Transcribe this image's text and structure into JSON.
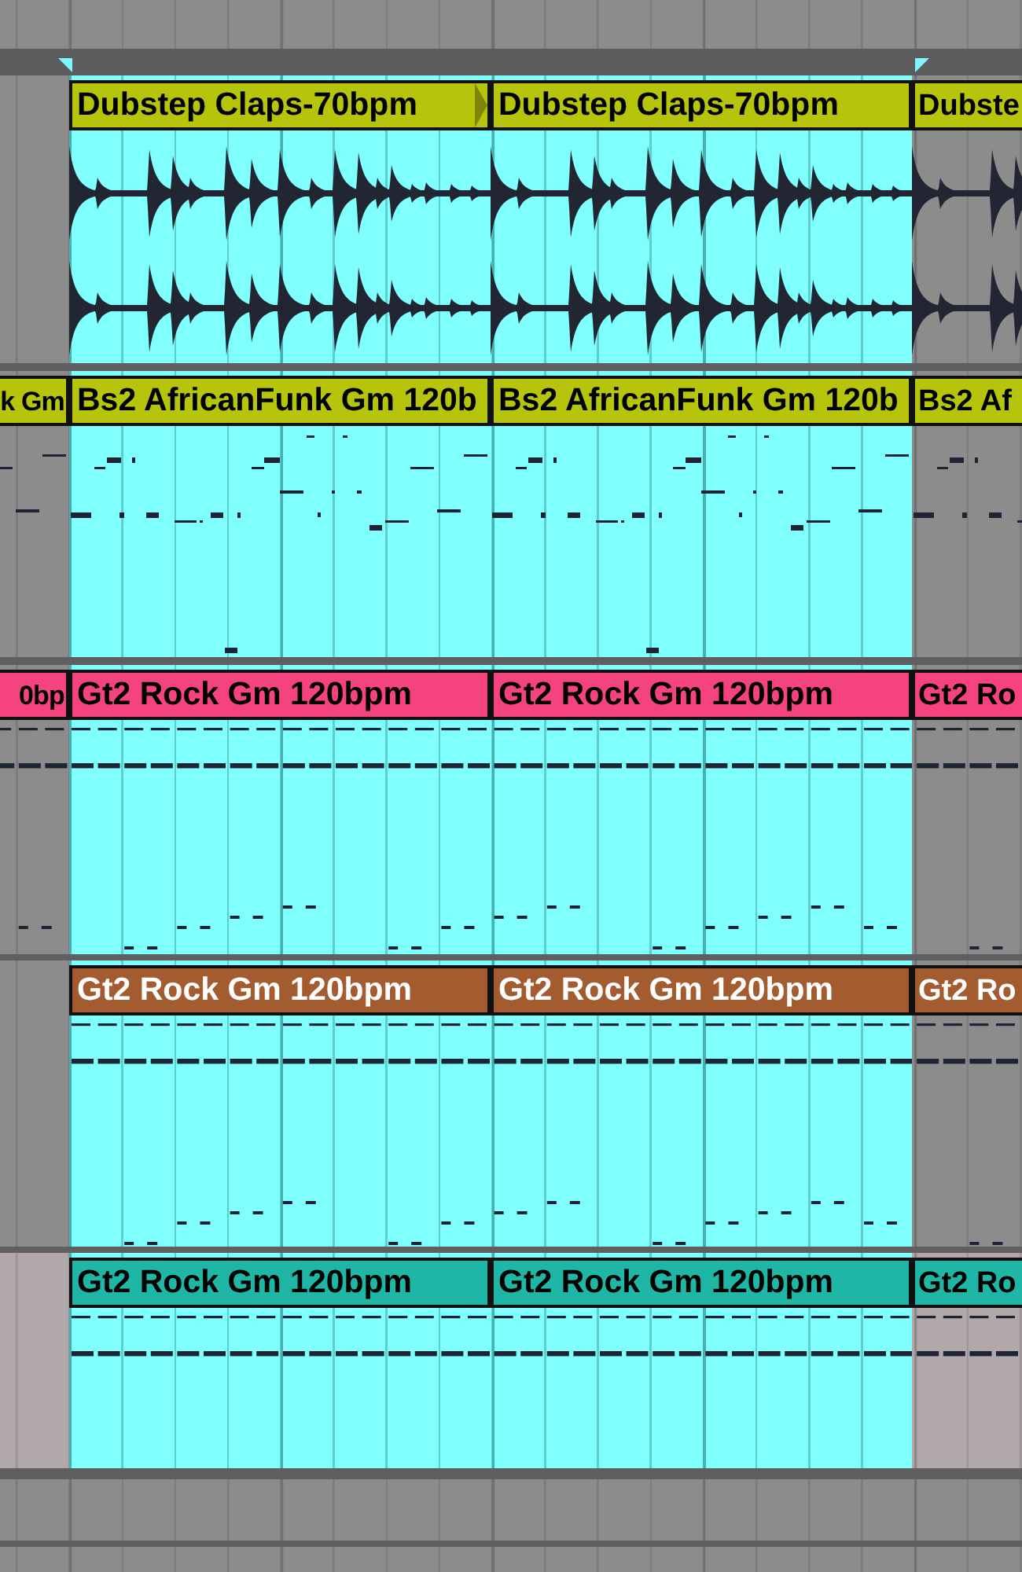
{
  "loop_brace": {
    "on": true
  },
  "tracks": [
    {
      "kind": "audio",
      "selected": false,
      "clips": [
        {
          "kind": "full",
          "name": "Dubstep Claps-70bpm",
          "color": "#b6c50b",
          "selected": true,
          "end_marker": true
        },
        {
          "kind": "full",
          "name": "Dubstep Claps-70bpm",
          "color": "#b6c50b",
          "selected": true,
          "end_marker": false
        },
        {
          "kind": "cut_right",
          "name": "Dubste",
          "color": "#b6c50b",
          "selected": false,
          "end_marker": false
        }
      ]
    },
    {
      "kind": "midi",
      "selected": false,
      "clips": [
        {
          "kind": "cut_left",
          "name": "k Gm",
          "color": "#b6c50b",
          "selected": false,
          "end_marker": false
        },
        {
          "kind": "full",
          "name": "Bs2 AfricanFunk Gm 120b",
          "color": "#b6c50b",
          "selected": true,
          "end_marker": false
        },
        {
          "kind": "full",
          "name": "Bs2 AfricanFunk Gm 120b",
          "color": "#b6c50b",
          "selected": true,
          "end_marker": false
        },
        {
          "kind": "cut_right",
          "name": "Bs2 Af",
          "color": "#b6c50b",
          "selected": false,
          "end_marker": false
        }
      ]
    },
    {
      "kind": "midi",
      "selected": false,
      "clips": [
        {
          "kind": "cut_left",
          "name": "0bp",
          "color": "#f4437f",
          "selected": false,
          "end_marker": false
        },
        {
          "kind": "full",
          "name": "Gt2 Rock Gm 120bpm",
          "color": "#f4437f",
          "selected": true,
          "end_marker": false
        },
        {
          "kind": "full",
          "name": "Gt2 Rock Gm 120bpm",
          "color": "#f4437f",
          "selected": true,
          "end_marker": false
        },
        {
          "kind": "cut_right",
          "name": "Gt2 Ro",
          "color": "#f4437f",
          "selected": false,
          "end_marker": false
        }
      ]
    },
    {
      "kind": "midi",
      "selected": false,
      "clips": [
        {
          "kind": "full",
          "name": "Gt2 Rock Gm 120bpm",
          "color": "#a35b30",
          "selected": true,
          "end_marker": false
        },
        {
          "kind": "full",
          "name": "Gt2 Rock Gm 120bpm",
          "color": "#a35b30",
          "selected": true,
          "end_marker": false
        },
        {
          "kind": "cut_right",
          "name": "Gt2 Ro",
          "color": "#a35b30",
          "selected": false,
          "end_marker": false
        }
      ]
    },
    {
      "kind": "midi",
      "selected": true,
      "clips": [
        {
          "kind": "full",
          "name": "Gt2 Rock Gm 120bpm",
          "color": "#1fb6a5",
          "selected": true,
          "end_marker": false
        },
        {
          "kind": "full",
          "name": "Gt2 Rock Gm 120bpm",
          "color": "#1fb6a5",
          "selected": true,
          "end_marker": false
        },
        {
          "kind": "cut_right",
          "name": "Gt2 Ro",
          "color": "#1fb6a5",
          "selected": false,
          "end_marker": false
        }
      ]
    }
  ]
}
